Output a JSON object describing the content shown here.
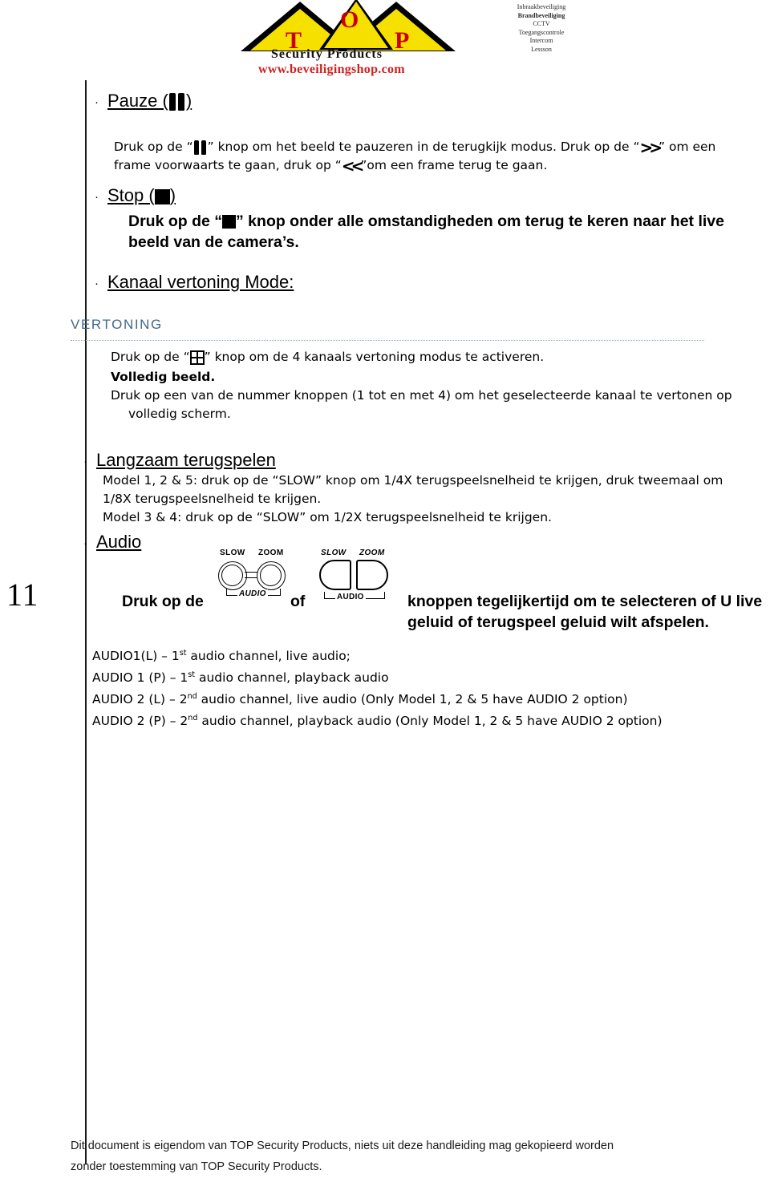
{
  "logo": {
    "letters": [
      "T",
      "O",
      "P"
    ],
    "company": "Security Products",
    "website": "www.beveiligingshop.com",
    "services": [
      "Inbraakbeveiliging",
      "Brandbeveiliging",
      "CCTV",
      "Toegangscontrole",
      "Intercom",
      "Lessson"
    ],
    "colors": {
      "triangle_fill": "#f5e000",
      "triangle_stroke": "#000000",
      "letter": "#cc0000",
      "url": "#cc2222"
    }
  },
  "page_number": "11",
  "sections": {
    "pauze": {
      "heading": "Pauze (",
      "heading_close": ")",
      "para_1": "Druk op de “",
      "para_2": "” knop om het beeld te pauzeren in de terugkijk modus. Druk op de “",
      "para_3": "” om een frame voorwaarts te gaan, druk op “",
      "para_4": "”om een frame terug te gaan.",
      "icon_pause": "pause-icon",
      "icon_forward": "fast-forward-icon",
      "icon_rewind": "rewind-icon"
    },
    "stop": {
      "heading": "Stop (",
      "heading_close": ")",
      "para_1": "Druk op de “",
      "para_2": "” knop onder alle omstandigheden om terug te keren naar het live beeld van de camera’s.",
      "icon_stop": "stop-icon"
    },
    "kanaal": {
      "heading": "Kanaal vertoning Mode:"
    },
    "vertoning": {
      "label": "VERTONING",
      "label_color": "#41698c",
      "para_1": "Druk op de “",
      "para_2": "” knop om de 4 kanaals vertoning modus te activeren.",
      "bold_line": "Volledig beeld.",
      "para_3": "Druk op een van de nummer knoppen (1 tot en met 4) om het geselecteerde kanaal te vertonen op volledig scherm.",
      "icon_quad": "quad-view-icon"
    },
    "langzaam": {
      "heading": "Langzaam terugspelen",
      "line_1": "Model 1, 2 & 5: druk op de “SLOW” knop om 1/4X terugspeelsnelheid te krijgen, druk tweemaal om 1/8X terugspeelsnelheid te krijgen.",
      "line_2": "Model 3 & 4: druk op de  “SLOW” om  1/2X terugspeelsnelheid te krijgen."
    },
    "audio": {
      "heading": "Audio",
      "bold_1": "Druk op de",
      "bold_of": "of",
      "bold_2": "knoppen tegelijkertijd om te selecteren of U live geluid of terugspeel geluid wilt afspelen.",
      "diagram_a": {
        "label_slow": "SLOW",
        "label_zoom": "ZOOM",
        "label_audio": "AUDIO"
      },
      "diagram_b": {
        "label_slow": "SLOW",
        "label_zoom": "ZOOM",
        "label_audio": "AUDIO"
      },
      "channels": [
        {
          "name": "AUDIO1(L)",
          "dash": " – 1",
          "sup": "st",
          "rest": " audio channel, live audio;"
        },
        {
          "name": "AUDIO 1 (P)",
          "dash": " – 1",
          "sup": "st",
          "rest": " audio channel, playback audio"
        },
        {
          "name": "AUDIO 2 (L)",
          "dash": " – 2",
          "sup": "nd",
          "rest": " audio channel, live audio (Only Model 1, 2 & 5 have AUDIO 2 option)"
        },
        {
          "name": "AUDIO 2 (P)",
          "dash": " – 2",
          "sup": "nd",
          "rest": " audio channel, playback audio (Only Model 1, 2 & 5 have AUDIO 2 option)"
        }
      ]
    }
  },
  "footer": {
    "line_1": "Dit document is eigendom van TOP Security Products, niets uit deze handleiding mag gekopieerd worden",
    "line_2": "zonder toestemming van TOP Security Products."
  }
}
